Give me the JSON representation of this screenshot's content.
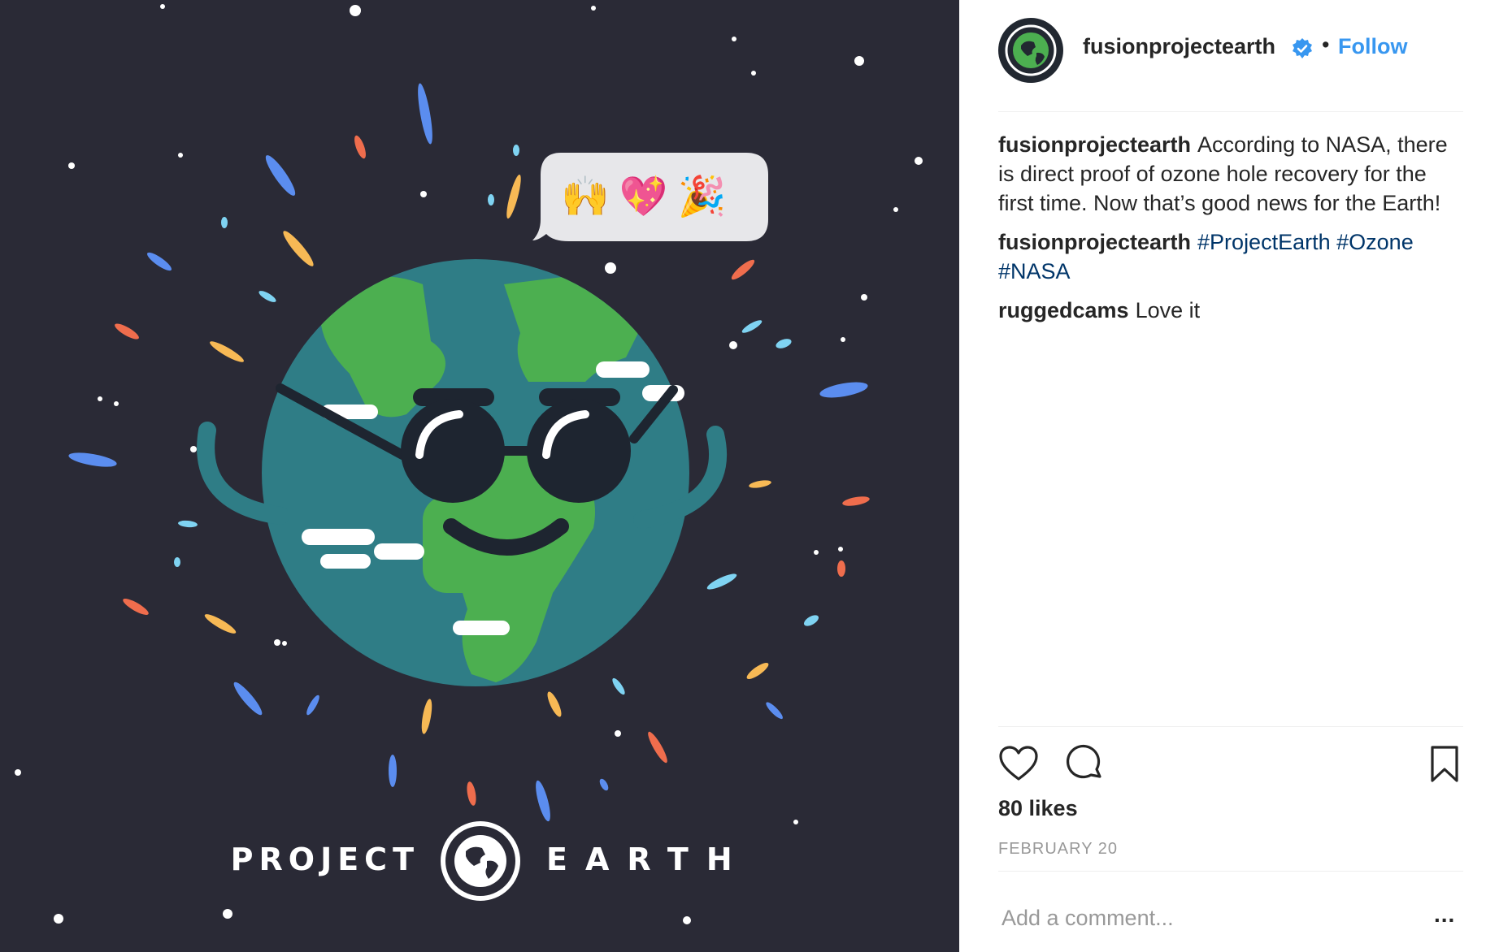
{
  "media": {
    "emoji": [
      "🙌",
      "💖",
      "🎉"
    ],
    "brand_left": "PROJECT",
    "brand_right": "EARTH"
  },
  "header": {
    "username": "fusionprojectearth",
    "separator": "•",
    "follow_label": "Follow"
  },
  "comments": [
    {
      "user": "fusionprojectearth",
      "text": "According to NASA, there is direct proof of ozone hole recovery for the first time. Now that’s good news for the Earth!"
    },
    {
      "user": "fusionprojectearth",
      "tags": [
        "#ProjectEarth",
        "#Ozone",
        "#NASA"
      ]
    },
    {
      "user": "ruggedcams",
      "text": "Love it"
    }
  ],
  "actions": {
    "icons": [
      "heart-icon",
      "comment-icon",
      "bookmark-icon"
    ],
    "likes": "80 likes",
    "date": "FEBRUARY 20"
  },
  "composer": {
    "placeholder": "Add a comment...",
    "more": "..."
  },
  "colors": {
    "media_bg": "#2a2a36",
    "ocean": "#2f7d86",
    "land": "#4caf50",
    "link": "#3897f0",
    "hashtag": "#003569"
  }
}
